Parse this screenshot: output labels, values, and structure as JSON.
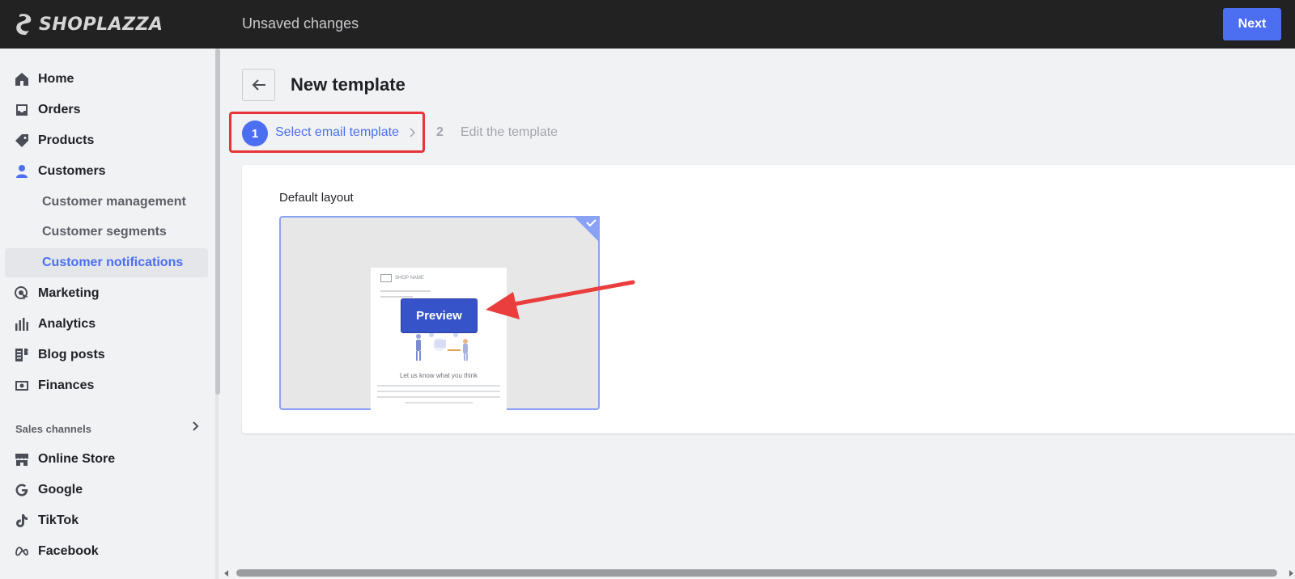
{
  "topbar": {
    "brand": "SHOPLAZZA",
    "status": "Unsaved changes",
    "next_label": "Next"
  },
  "sidebar": {
    "items": [
      {
        "label": "Home",
        "icon": "home-icon"
      },
      {
        "label": "Orders",
        "icon": "inbox-icon"
      },
      {
        "label": "Products",
        "icon": "tag-icon"
      },
      {
        "label": "Customers",
        "icon": "person-icon"
      }
    ],
    "customer_subitems": [
      {
        "label": "Customer management",
        "active": false
      },
      {
        "label": "Customer segments",
        "active": false
      },
      {
        "label": "Customer notifications",
        "active": true
      }
    ],
    "items_after": [
      {
        "label": "Marketing",
        "icon": "target-icon"
      },
      {
        "label": "Analytics",
        "icon": "bar-chart-icon"
      },
      {
        "label": "Blog posts",
        "icon": "document-icon"
      },
      {
        "label": "Finances",
        "icon": "wallet-icon"
      }
    ],
    "section_label": "Sales channels",
    "channels": [
      {
        "label": "Online Store",
        "icon": "store-icon"
      },
      {
        "label": "Google",
        "icon": "google-icon"
      },
      {
        "label": "TikTok",
        "icon": "tiktok-icon"
      },
      {
        "label": "Facebook",
        "icon": "meta-icon"
      }
    ]
  },
  "page": {
    "title": "New template",
    "steps": [
      {
        "number": "1",
        "label": "Select email template",
        "active": true
      },
      {
        "number": "2",
        "label": "Edit the template",
        "active": false
      }
    ]
  },
  "card": {
    "heading": "Default layout",
    "template": {
      "shop_name": "SHOP NAME",
      "email_heading": "Let us know what you think",
      "preview_label": "Preview",
      "selected": true
    }
  },
  "colors": {
    "topbar": "#222222",
    "accent": "#4c6ef0",
    "highlight": "#e8343a",
    "preview_button": "#3753c9"
  }
}
